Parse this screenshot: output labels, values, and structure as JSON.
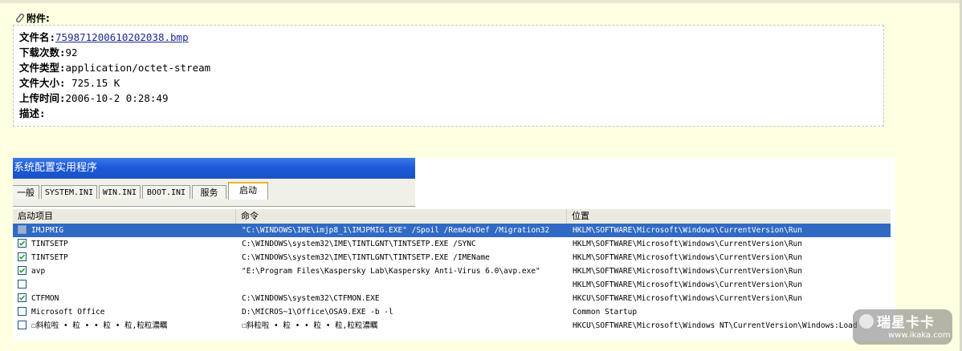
{
  "attachment": {
    "header": "附件:",
    "filename_label": "文件名:",
    "filename": "759871200610202038.bmp",
    "downloads_label": "下载次数:",
    "downloads": "92",
    "type_label": "文件类型:",
    "type": "application/octet-stream",
    "size_label": "文件大小:",
    "size": "725.15 K",
    "uploaded_label": "上传时间:",
    "uploaded": "2006-10-2 0:28:49",
    "desc_label": "描述:"
  },
  "window": {
    "title": "系统配置实用程序",
    "tabs": [
      "一般",
      "SYSTEM.INI",
      "WIN.INI",
      "BOOT.INI",
      "服务",
      "启动"
    ],
    "active_tab": "启动",
    "columns": [
      "启动项目",
      "命令",
      "位置"
    ],
    "rows": [
      {
        "checked": false,
        "selected": true,
        "item": "IMJPMIG",
        "command": "\"C:\\WINDOWS\\IME\\imjp8_1\\IMJPMIG.EXE\" /Spoil /RemAdvDef /Migration32",
        "location": "HKLM\\SOFTWARE\\Microsoft\\Windows\\CurrentVersion\\Run"
      },
      {
        "checked": true,
        "selected": false,
        "item": "TINTSETP",
        "command": "C:\\WINDOWS\\system32\\IME\\TINTLGNT\\TINTSETP.EXE /SYNC",
        "location": "HKLM\\SOFTWARE\\Microsoft\\Windows\\CurrentVersion\\Run"
      },
      {
        "checked": true,
        "selected": false,
        "item": "TINTSETP",
        "command": "C:\\WINDOWS\\system32\\IME\\TINTLGNT\\TINTSETP.EXE /IMEName",
        "location": "HKLM\\SOFTWARE\\Microsoft\\Windows\\CurrentVersion\\Run"
      },
      {
        "checked": true,
        "selected": false,
        "item": "avp",
        "command": "\"E:\\Program Files\\Kaspersky Lab\\Kaspersky Anti-Virus 6.0\\avp.exe\"",
        "location": "HKLM\\SOFTWARE\\Microsoft\\Windows\\CurrentVersion\\Run"
      },
      {
        "checked": false,
        "selected": false,
        "item": "",
        "command": "",
        "location": "HKLM\\SOFTWARE\\Microsoft\\Windows\\CurrentVersion\\Run"
      },
      {
        "checked": true,
        "selected": false,
        "item": "CTFMON",
        "command": "C:\\WINDOWS\\system32\\CTFMON.EXE",
        "location": "HKCU\\SOFTWARE\\Microsoft\\Windows\\CurrentVersion\\Run"
      },
      {
        "checked": false,
        "selected": false,
        "item": "Microsoft Office",
        "command": "D:\\MICROS~1\\Office\\OSA9.EXE -b -l",
        "location": "Common Startup"
      },
      {
        "checked": false,
        "selected": false,
        "item": "☐斜粒啦 • 粒 • • 粒 • 粒,粒粒濃瞩",
        "command": "☐斜粒啦 • 粒 • • 粒 • 粒,粒粒濃瞩",
        "location": "HKCU\\SOFTWARE\\Microsoft\\Windows NT\\CurrentVersion\\Windows:Load"
      }
    ]
  },
  "watermark": {
    "title": "瑞星卡卡",
    "url": "www.ikaka.com"
  }
}
